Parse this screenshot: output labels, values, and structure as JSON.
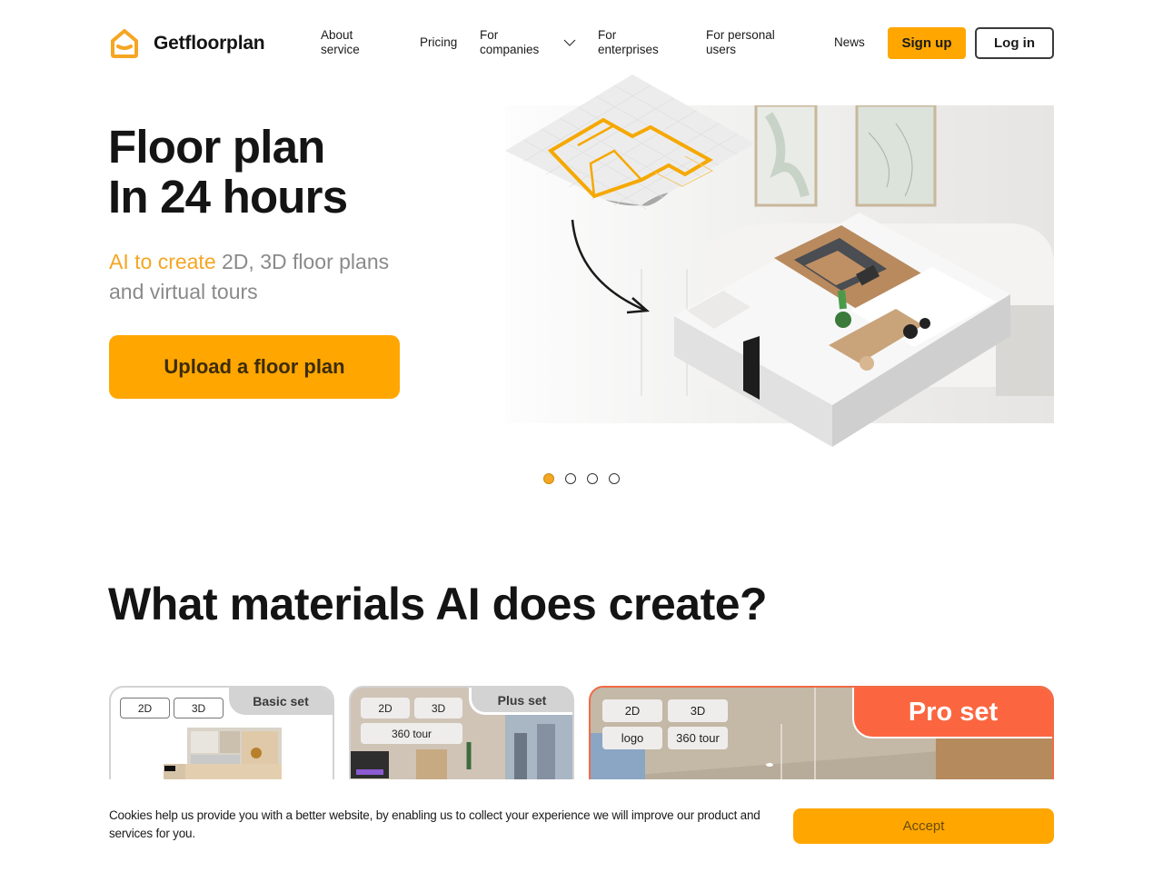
{
  "brand": {
    "name": "Getfloorplan",
    "accent_color": "#ffa600",
    "pro_color": "#fb6640"
  },
  "nav": {
    "items": [
      {
        "label_line1": "About",
        "label_line2": "service"
      },
      {
        "label": "Pricing"
      },
      {
        "label_line1": "For",
        "label_line2": "companies",
        "has_dropdown": true
      },
      {
        "label_line1": "For",
        "label_line2": "enterprises"
      },
      {
        "label_line1": "For personal",
        "label_line2": "users"
      },
      {
        "label": "News"
      }
    ],
    "signup_label": "Sign up",
    "login_label": "Log in"
  },
  "hero": {
    "title_line1": "Floor plan",
    "title_line2": "In 24 hours",
    "subtitle_accent": "AI to create",
    "subtitle_rest_line1": " 2D, 3D floor plans",
    "subtitle_line2": "and virtual tours",
    "cta_label": "Upload a floor plan",
    "carousel": {
      "total_slides": 4,
      "active_index": 0
    }
  },
  "materials": {
    "title": "What materials AI does create?",
    "cards": [
      {
        "name": "Basic set",
        "chips": [
          "2D",
          "3D"
        ]
      },
      {
        "name": "Plus set",
        "chips": [
          "2D",
          "3D",
          "360 tour"
        ]
      },
      {
        "name": "Pro set",
        "chips": [
          "2D",
          "3D",
          "logo",
          "360 tour"
        ]
      }
    ]
  },
  "cookie": {
    "text": "Cookies help us provide you with a better website, by enabling us to collect your experience we will improve our product and services for you.",
    "accept_label": "Accept"
  }
}
